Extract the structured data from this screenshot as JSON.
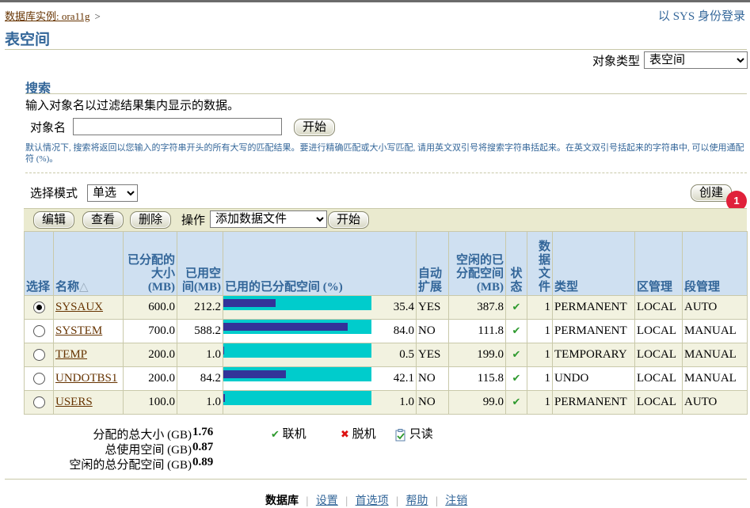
{
  "header": {
    "breadcrumb_link": "数据库实例: ora11g",
    "breadcrumb_sep": ">",
    "login": "以 SYS 身份登录",
    "title": "表空间"
  },
  "object_type": {
    "label": "对象类型",
    "selected": "表空间"
  },
  "search": {
    "heading": "搜索",
    "description": "输入对象名以过滤结果集内显示的数据。",
    "field_label": "对象名",
    "field_value": "",
    "go_label": "开始",
    "hint": "默认情况下, 搜索将返回以您输入的字符串开头的所有大写的匹配结果。要进行精确匹配或大小写匹配, 请用英文双引号将搜索字符串括起来。在英文双引号括起来的字符串中, 可以使用通配符 (%)。"
  },
  "selection": {
    "label": "选择模式",
    "selected": "单选"
  },
  "create_button": "创建",
  "badge": "1",
  "toolbar": {
    "edit": "编辑",
    "view": "查看",
    "delete": "删除",
    "action_label": "操作",
    "action_selected": "添加数据文件",
    "go": "开始"
  },
  "table": {
    "headers": {
      "select": "选择",
      "name": "名称",
      "allocated": "已分配的大小(MB)",
      "used": "已用空间(MB)",
      "used_pct": "已用的已分配空间 (%)",
      "autoext": "自动扩展",
      "free": "空闲的已分配空间(MB)",
      "status": "状态",
      "datafiles": "数据文件",
      "type": "类型",
      "extent": "区管理",
      "segment": "段管理"
    },
    "sort_icon": "△",
    "rows": [
      {
        "selected": true,
        "name": "SYSAUX",
        "allocated": "600.0",
        "used": "212.2",
        "pct": "35.4",
        "pct_value": 35.4,
        "autoext": "YES",
        "free": "387.8",
        "files": "1",
        "type": "PERMANENT",
        "extent": "LOCAL",
        "segment": "AUTO"
      },
      {
        "selected": false,
        "name": "SYSTEM",
        "allocated": "700.0",
        "used": "588.2",
        "pct": "84.0",
        "pct_value": 84.0,
        "autoext": "NO",
        "free": "111.8",
        "files": "1",
        "type": "PERMANENT",
        "extent": "LOCAL",
        "segment": "MANUAL"
      },
      {
        "selected": false,
        "name": "TEMP",
        "allocated": "200.0",
        "used": "1.0",
        "pct": "0.5",
        "pct_value": 0.5,
        "autoext": "YES",
        "free": "199.0",
        "files": "1",
        "type": "TEMPORARY",
        "extent": "LOCAL",
        "segment": "MANUAL"
      },
      {
        "selected": false,
        "name": "UNDOTBS1",
        "allocated": "200.0",
        "used": "84.2",
        "pct": "42.1",
        "pct_value": 42.1,
        "autoext": "NO",
        "free": "115.8",
        "files": "1",
        "type": "UNDO",
        "extent": "LOCAL",
        "segment": "MANUAL"
      },
      {
        "selected": false,
        "name": "USERS",
        "allocated": "100.0",
        "used": "1.0",
        "pct": "1.0",
        "pct_value": 1.0,
        "autoext": "NO",
        "free": "99.0",
        "files": "1",
        "type": "PERMANENT",
        "extent": "LOCAL",
        "segment": "AUTO"
      }
    ]
  },
  "summary": {
    "total_alloc_label": "分配的总大小 (GB)",
    "total_alloc": "1.76",
    "total_used_label": "总使用空间 (GB)",
    "total_used": "0.87",
    "total_free_label": "空闲的总分配空间 (GB)",
    "total_free": "0.89"
  },
  "legend": {
    "online": "联机",
    "offline": "脱机",
    "readonly": "只读"
  },
  "colors": {
    "header_text": "#336699",
    "bar_used": "#333399",
    "bar_free": "#00cccc",
    "badge": "#e0213a"
  },
  "footer": {
    "links": [
      "数据库",
      "设置",
      "首选项",
      "帮助",
      "注销"
    ]
  }
}
